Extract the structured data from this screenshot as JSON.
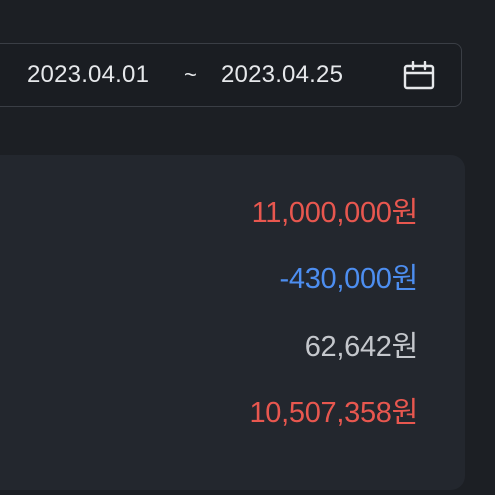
{
  "date_range": {
    "start": "2023.04.01",
    "separator": "~",
    "end": "2023.04.25"
  },
  "summary": {
    "amounts": [
      {
        "text": "11,000,000원",
        "color": "#e8574f"
      },
      {
        "text": "-430,000원",
        "color": "#4d8ef0"
      },
      {
        "text": "62,642원",
        "color": "#c4c7cc"
      },
      {
        "text": "10,507,358원",
        "color": "#e8574f"
      }
    ]
  },
  "icons": {
    "calendar": "calendar-icon"
  }
}
